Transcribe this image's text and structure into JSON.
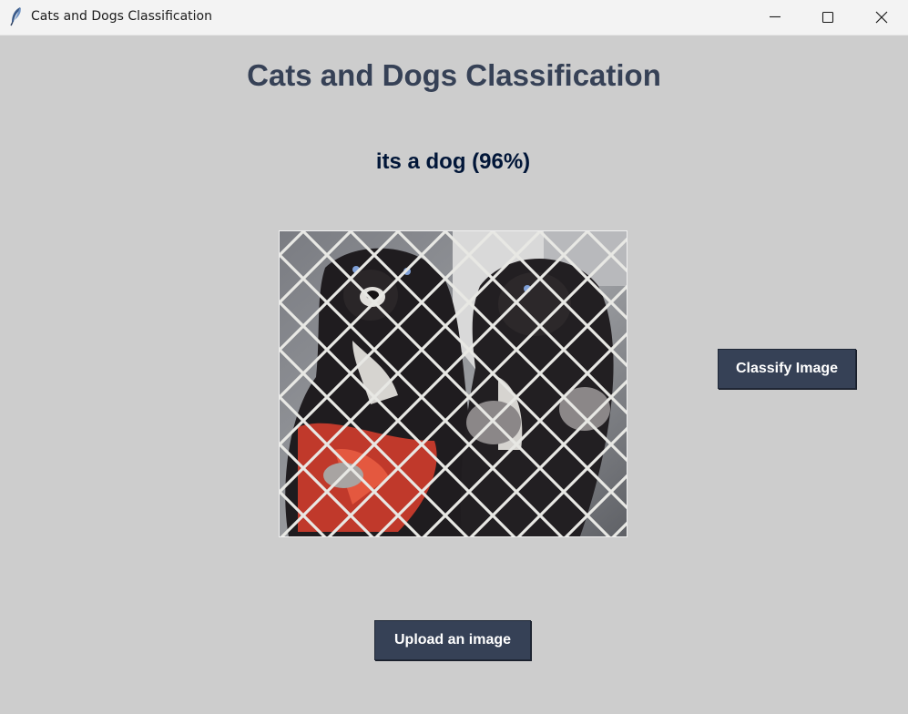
{
  "window": {
    "title": "Cats and Dogs Classification",
    "icon": "feather-icon",
    "controls": [
      "minimize-icon",
      "maximize-icon",
      "close-icon"
    ]
  },
  "main": {
    "heading": "Cats and Dogs Classification",
    "result": "its a dog (96%)",
    "image_description": "photo of two black puppies behind a chain-link fence",
    "classify_label": "Classify Image",
    "upload_label": "Upload an image"
  },
  "colors": {
    "background": "#cdcdcd",
    "heading": "#364156",
    "result": "#011638",
    "button_bg": "#364156",
    "button_text": "#ffffff"
  }
}
